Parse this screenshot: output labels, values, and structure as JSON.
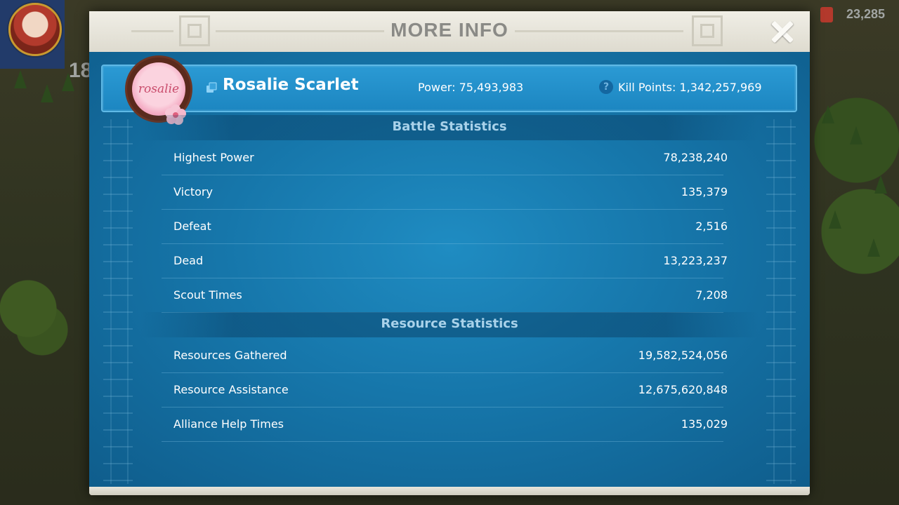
{
  "modal": {
    "title": "MORE INFO",
    "close_icon": "close-icon"
  },
  "player": {
    "avatar_text": "rosalie",
    "name": "Rosalie Scarlet",
    "power": "Power: 75,493,983",
    "kill_points": "Kill Points: 1,342,257,969",
    "help_icon": "?"
  },
  "battle": {
    "title": "Battle Statistics",
    "rows": [
      {
        "label": "Highest Power",
        "value": "78,238,240"
      },
      {
        "label": "Victory",
        "value": "135,379"
      },
      {
        "label": "Defeat",
        "value": "2,516"
      },
      {
        "label": "Dead",
        "value": "13,223,237"
      },
      {
        "label": "Scout Times",
        "value": "7,208"
      }
    ]
  },
  "resource": {
    "title": "Resource Statistics",
    "rows": [
      {
        "label": "Resources Gathered",
        "value": "19,582,524,056"
      },
      {
        "label": "Resource Assistance",
        "value": "12,675,620,848"
      },
      {
        "label": "Alliance Help Times",
        "value": "135,029"
      }
    ]
  },
  "hud": {
    "level": "18",
    "gems": "23,285"
  },
  "colors": {
    "panel_blue": "#1676aa",
    "banner_blue": "#2b9ad4",
    "header_cream": "#e9e7dd",
    "title_gray": "#8a8a86",
    "section_text": "#a9d2ea"
  }
}
